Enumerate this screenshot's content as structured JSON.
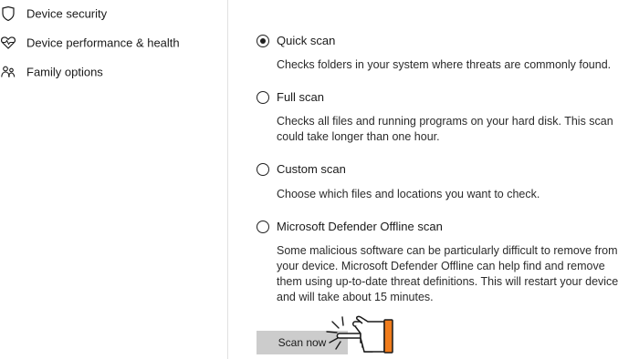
{
  "sidebar": {
    "items": [
      {
        "label": "Device security",
        "icon": "shield-icon"
      },
      {
        "label": "Device performance & health",
        "icon": "heart-icon"
      },
      {
        "label": "Family options",
        "icon": "family-icon"
      }
    ]
  },
  "scan_options": [
    {
      "title": "Quick scan",
      "description": "Checks folders in your system where threats are commonly found.",
      "selected": true
    },
    {
      "title": "Full scan",
      "description": "Checks all files and running programs on your hard disk. This scan could take longer than one hour.",
      "selected": false
    },
    {
      "title": "Custom scan",
      "description": "Choose which files and locations you want to check.",
      "selected": false
    },
    {
      "title": "Microsoft Defender Offline scan",
      "description": "Some malicious software can be particularly difficult to remove from your device. Microsoft Defender Offline can help find and remove them using up-to-date threat definitions. This will restart your device and will take about 15 minutes.",
      "selected": false
    }
  ],
  "actions": {
    "scan_now_label": "Scan now"
  },
  "overlay": {
    "icon": "pointing-hand-icon",
    "cuff_color": "#f07c1c"
  },
  "colors": {
    "button_bg": "#cccccc",
    "sidebar_divider": "#e1e1e1"
  }
}
